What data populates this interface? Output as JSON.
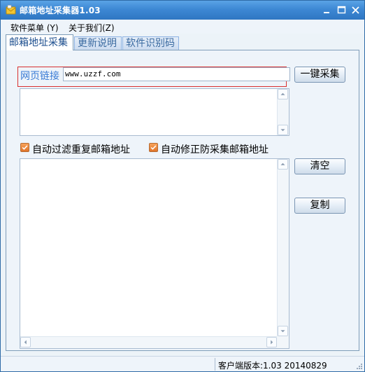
{
  "window": {
    "title": "邮箱地址采集器1.03"
  },
  "menu": {
    "items": [
      "软件菜单 (Y)",
      "关于我们(Z)"
    ]
  },
  "tabs": [
    "邮箱地址采集",
    "更新说明",
    "软件识别码"
  ],
  "url": {
    "label": "网页链接",
    "value": "www.uzzf.com"
  },
  "buttons": {
    "collect": "一键采集",
    "clear": "清空",
    "copy": "复制"
  },
  "options": {
    "dedupe": {
      "label": "自动过滤重复邮箱地址",
      "checked": true
    },
    "anti_collect": {
      "label": "自动修正防采集邮箱地址",
      "checked": true
    }
  },
  "status": {
    "version": "客户端版本:1.03 20140829"
  },
  "colors": {
    "titlebar": "#3d88d4",
    "accent_label": "#3a7bd5",
    "highlight_border": "#d83030",
    "checkbox": "#e0742a"
  }
}
